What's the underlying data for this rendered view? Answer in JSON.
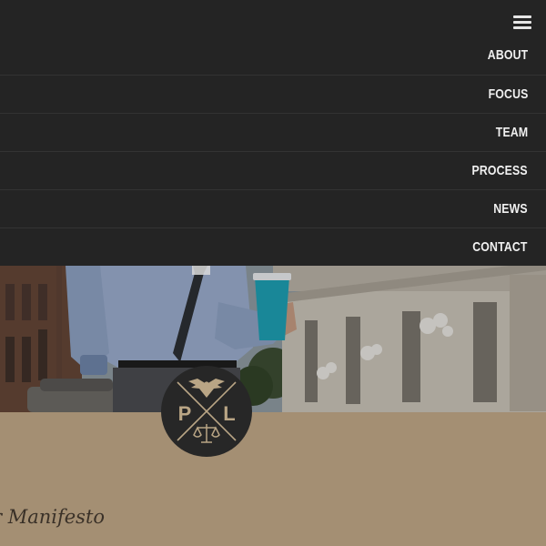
{
  "nav": {
    "menu_icon": "hamburger-menu-icon",
    "items": [
      {
        "label": "ABOUT"
      },
      {
        "label": "FOCUS"
      },
      {
        "label": "TEAM"
      },
      {
        "label": "PROCESS"
      },
      {
        "label": "NEWS"
      },
      {
        "label": "CONTACT"
      }
    ]
  },
  "hero": {
    "image": "man-with-coffee-cup-photo"
  },
  "logo": {
    "left_letter": "P",
    "right_letter": "L",
    "top_icon": "eagle-icon",
    "bottom_icon": "scales-of-justice-icon"
  },
  "section": {
    "heading": "r Manifesto"
  },
  "colors": {
    "nav_bg": "#242424",
    "band_bg": "#a48f73",
    "badge_bg": "#272727",
    "badge_ink": "#b9a585",
    "cup": "#1e9fb3"
  }
}
